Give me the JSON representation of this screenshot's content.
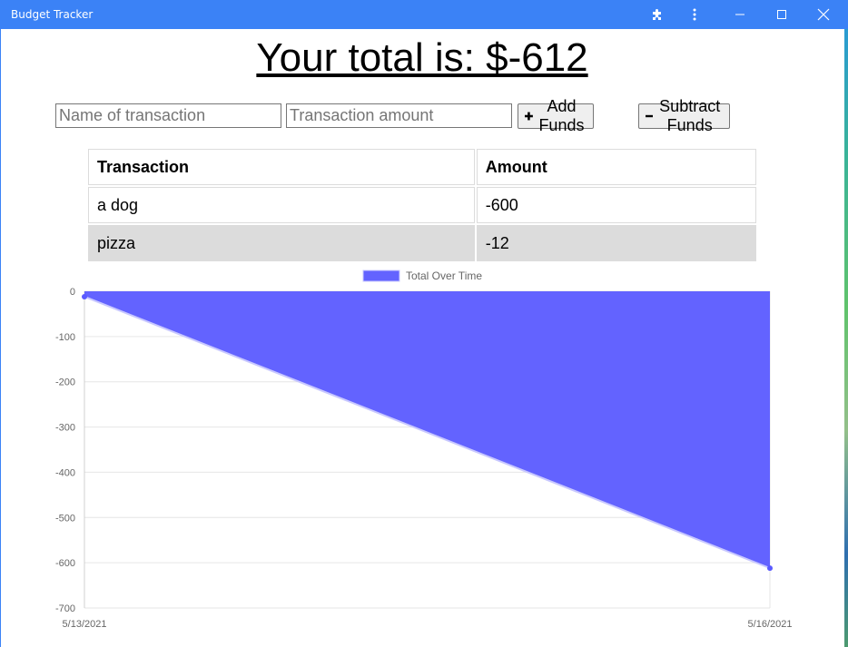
{
  "window": {
    "title": "Budget Tracker"
  },
  "total": {
    "text": "Your total is: $-612"
  },
  "form": {
    "name_placeholder": "Name of transaction",
    "amount_placeholder": "Transaction amount",
    "add_label": "Add Funds",
    "subtract_label": "Subtract Funds"
  },
  "table": {
    "headers": [
      "Transaction",
      "Amount"
    ],
    "rows": [
      {
        "name": "a dog",
        "amount": "-600"
      },
      {
        "name": "pizza",
        "amount": "-12"
      }
    ]
  },
  "colors": {
    "titlebar": "#3b82f6",
    "series_fill": "#6363ff",
    "series_line": "#5a5aff"
  },
  "chart_data": {
    "type": "area",
    "x": [
      "5/13/2021",
      "5/16/2021"
    ],
    "series": [
      {
        "name": "Total Over Time",
        "values": [
          -12,
          -612
        ]
      }
    ],
    "ylim": [
      -700,
      0
    ],
    "yticks": [
      0,
      -100,
      -200,
      -300,
      -400,
      -500,
      -600,
      -700
    ],
    "fill_to": 0,
    "grid": true,
    "legend": "top-center"
  }
}
